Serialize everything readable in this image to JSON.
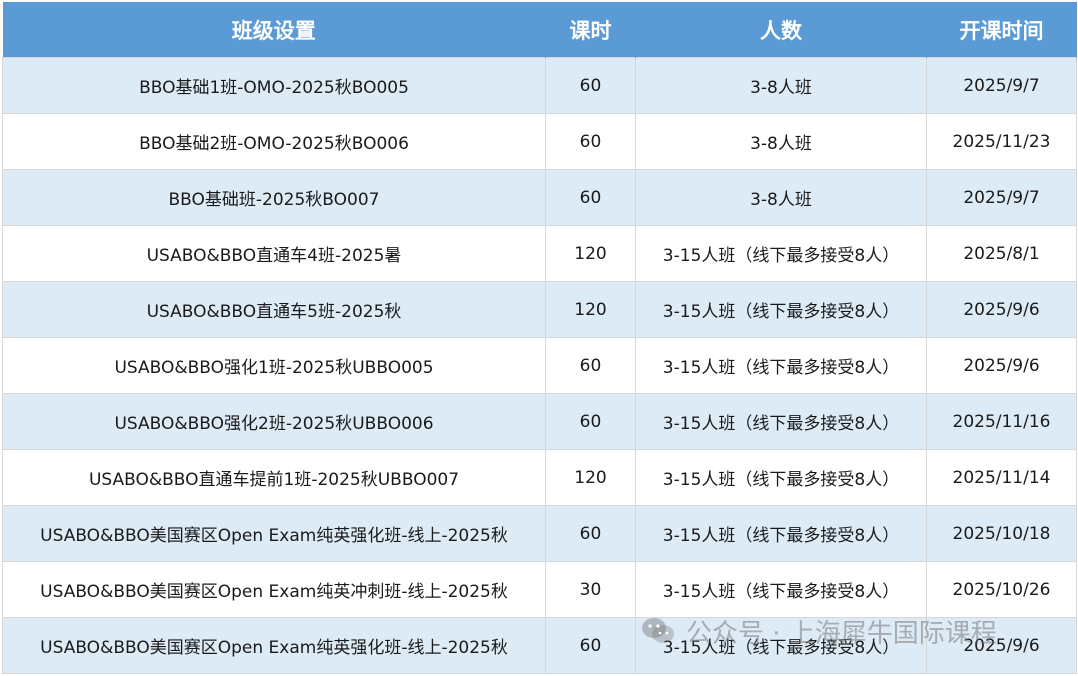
{
  "table": {
    "headers": [
      "班级设置",
      "课时",
      "人数",
      "开课时间"
    ],
    "rows": [
      [
        "BBO基础1班-OMO-2025秋BO005",
        "60",
        "3-8人班",
        "2025/9/7"
      ],
      [
        "BBO基础2班-OMO-2025秋BO006",
        "60",
        "3-8人班",
        "2025/11/23"
      ],
      [
        "BBO基础班-2025秋BO007",
        "60",
        "3-8人班",
        "2025/9/7"
      ],
      [
        "USABO&BBO直通车4班-2025暑",
        "120",
        "3-15人班（线下最多接受8人）",
        "2025/8/1"
      ],
      [
        "USABO&BBO直通车5班-2025秋",
        "120",
        "3-15人班（线下最多接受8人）",
        "2025/9/6"
      ],
      [
        "USABO&BBO强化1班-2025秋UBBO005",
        "60",
        "3-15人班（线下最多接受8人）",
        "2025/9/6"
      ],
      [
        "USABO&BBO强化2班-2025秋UBBO006",
        "60",
        "3-15人班（线下最多接受8人）",
        "2025/11/16"
      ],
      [
        "USABO&BBO直通车提前1班-2025秋UBBO007",
        "120",
        "3-15人班（线下最多接受8人）",
        "2025/11/14"
      ],
      [
        "USABO&BBO美国赛区Open Exam纯英强化班-线上-2025秋",
        "60",
        "3-15人班（线下最多接受8人）",
        "2025/10/18"
      ],
      [
        "USABO&BBO美国赛区Open Exam纯英冲刺班-线上-2025秋",
        "30",
        "3-15人班（线下最多接受8人）",
        "2025/10/26"
      ],
      [
        "USABO&BBO美国赛区Open Exam纯英强化班-线上-2025秋",
        "60",
        "3-15人班（线下最多接受8人）",
        "2025/9/6"
      ]
    ]
  },
  "watermark": {
    "text": "公众号 · 上海犀牛国际课程",
    "icon": "wechat-icon"
  },
  "colors": {
    "header_bg": "#5b9bd5",
    "stripe": "#ddebf7"
  }
}
